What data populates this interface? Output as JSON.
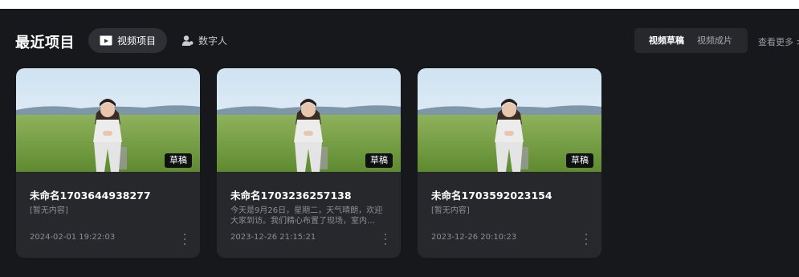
{
  "header": {
    "title": "最近项目",
    "tabs": [
      {
        "label": "视频项目",
        "icon": "video-play-icon",
        "active": true
      },
      {
        "label": "数字人",
        "icon": "digital-human-icon",
        "active": false
      }
    ],
    "segment": [
      {
        "label": "视频草稿",
        "active": true
      },
      {
        "label": "视频成片",
        "active": false
      }
    ],
    "see_more": "查看更多 >"
  },
  "cards": [
    {
      "title": "未命名1703644938277",
      "desc": "[暂无内容]",
      "date": "2024-02-01 19:22:03",
      "badge": "草稿"
    },
    {
      "title": "未命名1703236257138",
      "desc": "今天是9月26日，星期二，天气晴朗，欢迎大家到访。我们精心布置了现场，室内…",
      "date": "2023-12-26 21:15:21",
      "badge": "草稿"
    },
    {
      "title": "未命名1703592023154",
      "desc": "[暂无内容]",
      "date": "2023-12-26 20:10:23",
      "badge": "草稿"
    }
  ],
  "colors": {
    "panel_bg": "#17181b",
    "card_bg": "#26282c",
    "text_primary": "#ffffff",
    "text_secondary": "#8b8e94"
  }
}
